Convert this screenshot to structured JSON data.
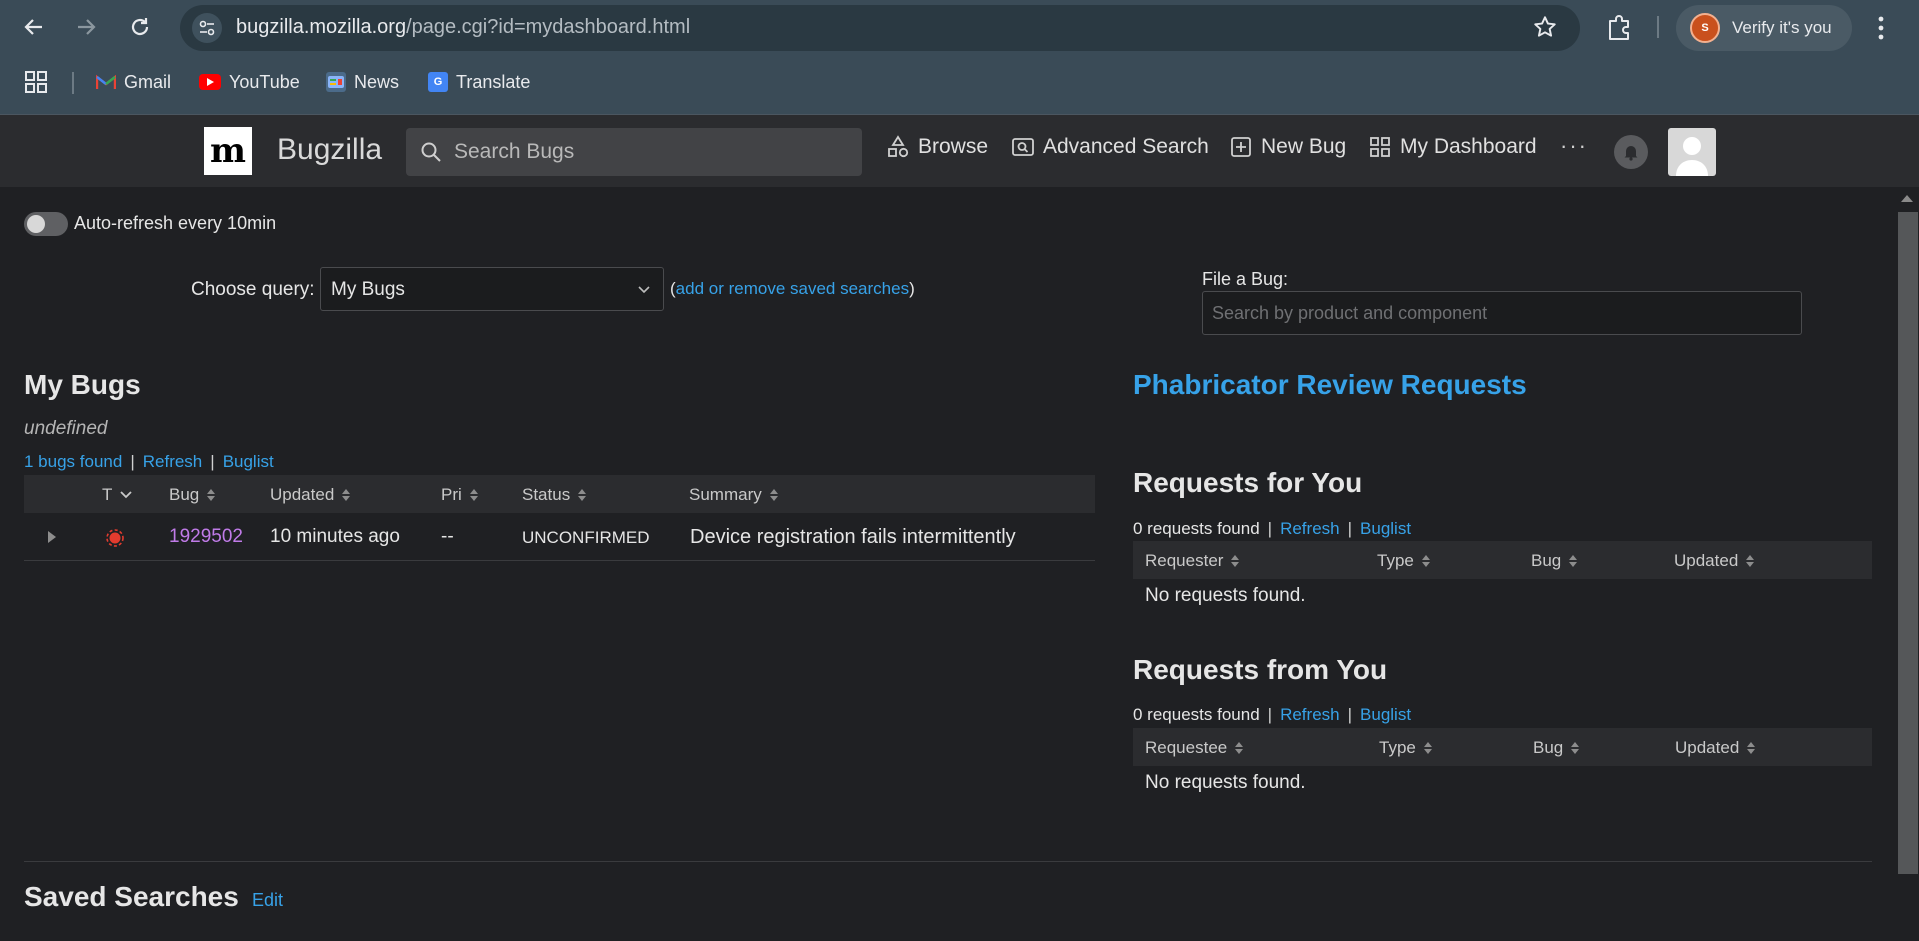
{
  "browser": {
    "url_domain": "bugzilla.mozilla.org",
    "url_path": "/page.cgi?id=mydashboard.html",
    "profile_label": "Verify it's you",
    "profile_initial": "S",
    "bookmarks": [
      {
        "label": "Gmail",
        "icon": "gmail-icon"
      },
      {
        "label": "YouTube",
        "icon": "youtube-icon"
      },
      {
        "label": "News",
        "icon": "news-icon"
      },
      {
        "label": "Translate",
        "icon": "translate-icon"
      }
    ]
  },
  "header": {
    "logo_text": "m",
    "title": "Bugzilla",
    "search_placeholder": "Search Bugs",
    "nav": {
      "browse": "Browse",
      "advanced_search": "Advanced Search",
      "new_bug": "New Bug",
      "my_dashboard": "My Dashboard"
    },
    "more": "···"
  },
  "dashboard": {
    "auto_refresh_label": "Auto-refresh every 10min",
    "auto_refresh_on": false,
    "choose_query_label": "Choose query:",
    "selected_query": "My Bugs",
    "saved_searches_link": "add or remove saved searches",
    "file_bug_label": "File a Bug:",
    "file_bug_placeholder": "Search by product and component"
  },
  "my_bugs": {
    "title": "My Bugs",
    "description": "undefined",
    "count_text": "1 bugs found",
    "refresh": "Refresh",
    "buglist": "Buglist",
    "columns": [
      "T",
      "Bug",
      "Updated",
      "Pri",
      "Status",
      "Summary"
    ],
    "rows": [
      {
        "type_icon": "defect-icon",
        "bug": "1929502",
        "updated": "10 minutes ago",
        "pri": "--",
        "status": "UNCONFIRMED",
        "summary": "Device registration fails intermittently"
      }
    ]
  },
  "phabricator": {
    "title": "Phabricator Review Requests"
  },
  "requests_for_you": {
    "title": "Requests for You",
    "count_text": "0 requests found",
    "refresh": "Refresh",
    "buglist": "Buglist",
    "columns": [
      "Requester",
      "Type",
      "Bug",
      "Updated"
    ],
    "empty": "No requests found."
  },
  "requests_from_you": {
    "title": "Requests from You",
    "count_text": "0 requests found",
    "refresh": "Refresh",
    "buglist": "Buglist",
    "columns": [
      "Requestee",
      "Type",
      "Bug",
      "Updated"
    ],
    "empty": "No requests found."
  },
  "saved_searches": {
    "title": "Saved Searches",
    "edit": "Edit"
  },
  "colors": {
    "link": "#37a2e8",
    "bug_link": "#c07be8",
    "defect": "#e33b2e",
    "page_bg": "#1f2023",
    "chrome_bg": "#3a4b57"
  }
}
